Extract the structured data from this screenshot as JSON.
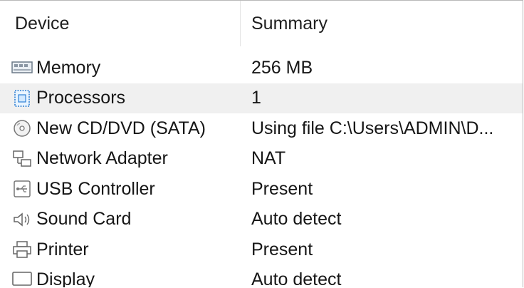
{
  "header": {
    "device": "Device",
    "summary": "Summary"
  },
  "rows": [
    {
      "icon": "memory-icon",
      "device": "Memory",
      "summary": "256 MB"
    },
    {
      "icon": "processor-icon",
      "device": "Processors",
      "summary": "1"
    },
    {
      "icon": "cd-dvd-icon",
      "device": "New CD/DVD (SATA)",
      "summary": "Using file C:\\Users\\ADMIN\\D..."
    },
    {
      "icon": "network-adapter-icon",
      "device": "Network Adapter",
      "summary": "NAT"
    },
    {
      "icon": "usb-icon",
      "device": "USB Controller",
      "summary": "Present"
    },
    {
      "icon": "sound-card-icon",
      "device": "Sound Card",
      "summary": "Auto detect"
    },
    {
      "icon": "printer-icon",
      "device": "Printer",
      "summary": "Present"
    },
    {
      "icon": "display-icon",
      "device": "Display",
      "summary": "Auto detect"
    }
  ],
  "selected_row": 1
}
